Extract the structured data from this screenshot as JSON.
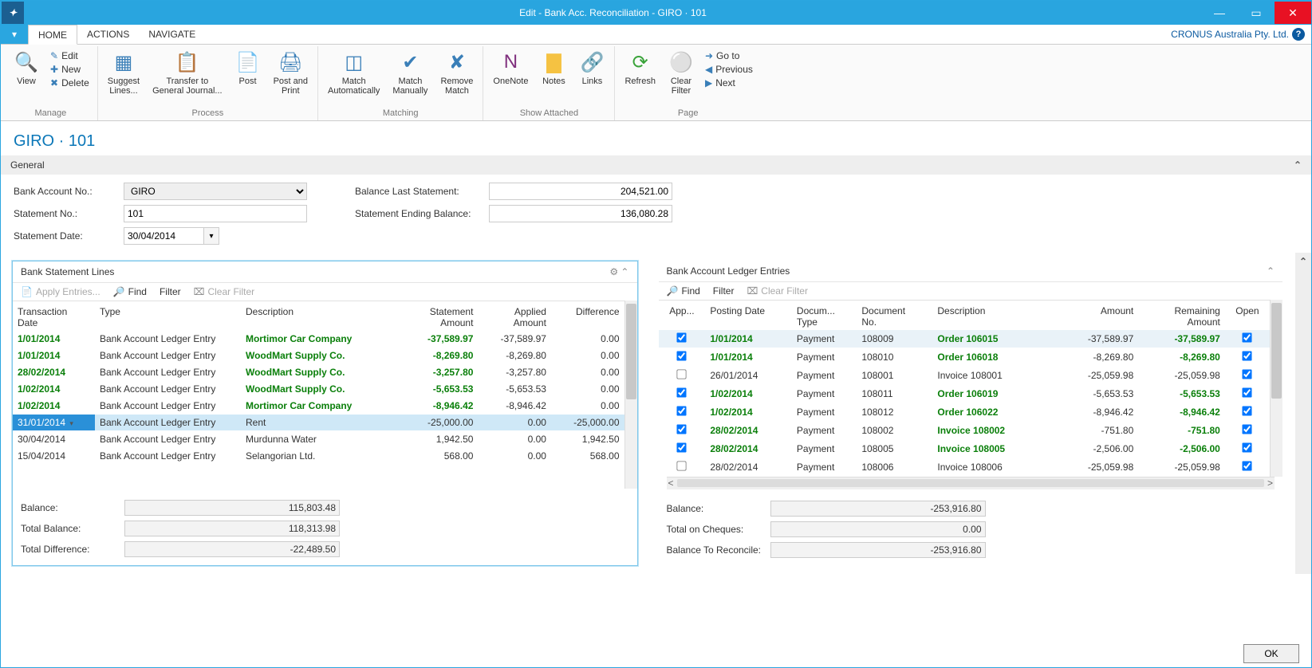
{
  "window": {
    "title": "Edit - Bank Acc. Reconciliation - GIRO · 101"
  },
  "tabs": {
    "home": "HOME",
    "actions": "ACTIONS",
    "navigate": "NAVIGATE",
    "org": "CRONUS Australia Pty. Ltd."
  },
  "ribbon": {
    "manage": {
      "label": "Manage",
      "view": "View",
      "edit": "Edit",
      "new": "New",
      "delete": "Delete"
    },
    "process": {
      "label": "Process",
      "suggest": "Suggest\nLines...",
      "transfer": "Transfer to\nGeneral Journal...",
      "post": "Post",
      "postprint": "Post and\nPrint"
    },
    "matching": {
      "label": "Matching",
      "auto": "Match\nAutomatically",
      "manual": "Match\nManually",
      "remove": "Remove\nMatch"
    },
    "showattached": {
      "label": "Show Attached",
      "onenote": "OneNote",
      "notes": "Notes",
      "links": "Links"
    },
    "page": {
      "label": "Page",
      "refresh": "Refresh",
      "clear": "Clear\nFilter",
      "goto": "Go to",
      "prev": "Previous",
      "next": "Next"
    }
  },
  "page_title": "GIRO · 101",
  "general": {
    "header": "General",
    "bank_no_lbl": "Bank Account No.:",
    "bank_no": "GIRO",
    "stmt_no_lbl": "Statement No.:",
    "stmt_no": "101",
    "stmt_date_lbl": "Statement Date:",
    "stmt_date": "30/04/2014",
    "bal_last_lbl": "Balance Last Statement:",
    "bal_last": "204,521.00",
    "stmt_end_lbl": "Statement Ending Balance:",
    "stmt_end": "136,080.28"
  },
  "left_panel": {
    "title": "Bank Statement Lines",
    "tools": {
      "apply": "Apply Entries...",
      "find": "Find",
      "filter": "Filter",
      "clear": "Clear Filter"
    },
    "cols": {
      "date": "Transaction\nDate",
      "type": "Type",
      "desc": "Description",
      "stmt_amt": "Statement\nAmount",
      "app_amt": "Applied\nAmount",
      "diff": "Difference"
    },
    "rows": [
      {
        "matched": true,
        "date": "1/01/2014",
        "type": "Bank Account Ledger Entry",
        "desc": "Mortimor Car Company",
        "stmt": "-37,589.97",
        "app": "-37,589.97",
        "diff": "0.00"
      },
      {
        "matched": true,
        "date": "1/01/2014",
        "type": "Bank Account Ledger Entry",
        "desc": "WoodMart Supply Co.",
        "stmt": "-8,269.80",
        "app": "-8,269.80",
        "diff": "0.00"
      },
      {
        "matched": true,
        "date": "28/02/2014",
        "type": "Bank Account Ledger Entry",
        "desc": "WoodMart Supply Co.",
        "stmt": "-3,257.80",
        "app": "-3,257.80",
        "diff": "0.00"
      },
      {
        "matched": true,
        "date": "1/02/2014",
        "type": "Bank Account Ledger Entry",
        "desc": "WoodMart Supply Co.",
        "stmt": "-5,653.53",
        "app": "-5,653.53",
        "diff": "0.00"
      },
      {
        "matched": true,
        "date": "1/02/2014",
        "type": "Bank Account Ledger Entry",
        "desc": "Mortimor Car Company",
        "stmt": "-8,946.42",
        "app": "-8,946.42",
        "diff": "0.00"
      },
      {
        "matched": false,
        "selected": true,
        "date": "31/01/2014",
        "type": "Bank Account Ledger Entry",
        "desc": "Rent",
        "stmt": "-25,000.00",
        "app": "0.00",
        "diff": "-25,000.00"
      },
      {
        "matched": false,
        "date": "30/04/2014",
        "type": "Bank Account Ledger Entry",
        "desc": "Murdunna Water",
        "stmt": "1,942.50",
        "app": "0.00",
        "diff": "1,942.50"
      },
      {
        "matched": false,
        "date": "15/04/2014",
        "type": "Bank Account Ledger Entry",
        "desc": "Selangorian Ltd.",
        "stmt": "568.00",
        "app": "0.00",
        "diff": "568.00"
      }
    ],
    "sum": {
      "bal_lbl": "Balance:",
      "bal": "115,803.48",
      "tbal_lbl": "Total Balance:",
      "tbal": "118,313.98",
      "tdiff_lbl": "Total Difference:",
      "tdiff": "-22,489.50"
    }
  },
  "right_panel": {
    "title": "Bank Account Ledger Entries",
    "tools": {
      "find": "Find",
      "filter": "Filter",
      "clear": "Clear Filter"
    },
    "cols": {
      "app": "App...",
      "pdate": "Posting Date",
      "dtype": "Docum...\nType",
      "dno": "Document\nNo.",
      "desc": "Description",
      "amt": "Amount",
      "rem": "Remaining\nAmount",
      "open": "Open"
    },
    "rows": [
      {
        "app": true,
        "matched": true,
        "highlight": true,
        "pd": "1/01/2014",
        "dt": "Payment",
        "dn": "108009",
        "de": "Order 106015",
        "am": "-37,589.97",
        "re": "-37,589.97",
        "op": true
      },
      {
        "app": true,
        "matched": true,
        "pd": "1/01/2014",
        "dt": "Payment",
        "dn": "108010",
        "de": "Order 106018",
        "am": "-8,269.80",
        "re": "-8,269.80",
        "op": true
      },
      {
        "app": false,
        "matched": false,
        "pd": "26/01/2014",
        "dt": "Payment",
        "dn": "108001",
        "de": "Invoice 108001",
        "am": "-25,059.98",
        "re": "-25,059.98",
        "op": true
      },
      {
        "app": true,
        "matched": true,
        "pd": "1/02/2014",
        "dt": "Payment",
        "dn": "108011",
        "de": "Order 106019",
        "am": "-5,653.53",
        "re": "-5,653.53",
        "op": true
      },
      {
        "app": true,
        "matched": true,
        "pd": "1/02/2014",
        "dt": "Payment",
        "dn": "108012",
        "de": "Order 106022",
        "am": "-8,946.42",
        "re": "-8,946.42",
        "op": true
      },
      {
        "app": true,
        "matched": true,
        "pd": "28/02/2014",
        "dt": "Payment",
        "dn": "108002",
        "de": "Invoice 108002",
        "am": "-751.80",
        "re": "-751.80",
        "op": true
      },
      {
        "app": true,
        "matched": true,
        "pd": "28/02/2014",
        "dt": "Payment",
        "dn": "108005",
        "de": "Invoice 108005",
        "am": "-2,506.00",
        "re": "-2,506.00",
        "op": true
      },
      {
        "app": false,
        "matched": false,
        "pd": "28/02/2014",
        "dt": "Payment",
        "dn": "108006",
        "de": "Invoice 108006",
        "am": "-25,059.98",
        "re": "-25,059.98",
        "op": true
      }
    ],
    "sum": {
      "bal_lbl": "Balance:",
      "bal": "-253,916.80",
      "chq_lbl": "Total on Cheques:",
      "chq": "0.00",
      "rec_lbl": "Balance To Reconcile:",
      "rec": "-253,916.80"
    }
  },
  "footer": {
    "ok": "OK"
  }
}
